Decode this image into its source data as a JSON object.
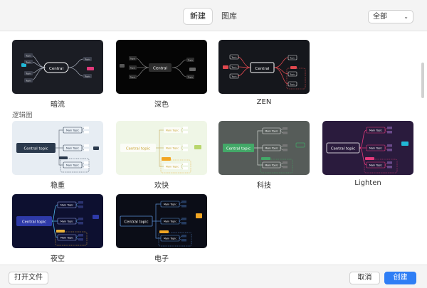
{
  "header": {
    "tabs": [
      {
        "label": "新建",
        "active": true
      },
      {
        "label": "图库",
        "active": false
      }
    ],
    "filter": {
      "value": "全部"
    }
  },
  "sections": [
    {
      "label": "",
      "cards": [
        {
          "label": "暗流",
          "theme": "anliu"
        },
        {
          "label": "深色",
          "theme": "shense"
        },
        {
          "label": "ZEN",
          "theme": "zen"
        }
      ]
    },
    {
      "label": "逻辑图",
      "cards": [
        {
          "label": "稳重",
          "theme": "wenzhong"
        },
        {
          "label": "欢快",
          "theme": "huankuai"
        },
        {
          "label": "科技",
          "theme": "keji"
        },
        {
          "label": "Lighten",
          "theme": "lighten"
        },
        {
          "label": "夜空",
          "theme": "yekong"
        },
        {
          "label": "电子",
          "theme": "dianzi"
        }
      ]
    }
  ],
  "thumb_text": {
    "central": "Central",
    "topic": "Topic",
    "central_topic": "Central topic",
    "main_topic": "Main Topic"
  },
  "footer": {
    "open_label": "打开文件",
    "cancel_label": "取消",
    "create_label": "创建"
  },
  "colors": {
    "accent": "#2f7ef5",
    "dark_card": "#1b1d24",
    "black_card": "#050505",
    "zen_red": "#e0484e",
    "cyan": "#21b8d6",
    "lighten_bg": "#2a1b3d",
    "night_bg": "#0d1030",
    "electronic_bg": "#0b0d17"
  }
}
